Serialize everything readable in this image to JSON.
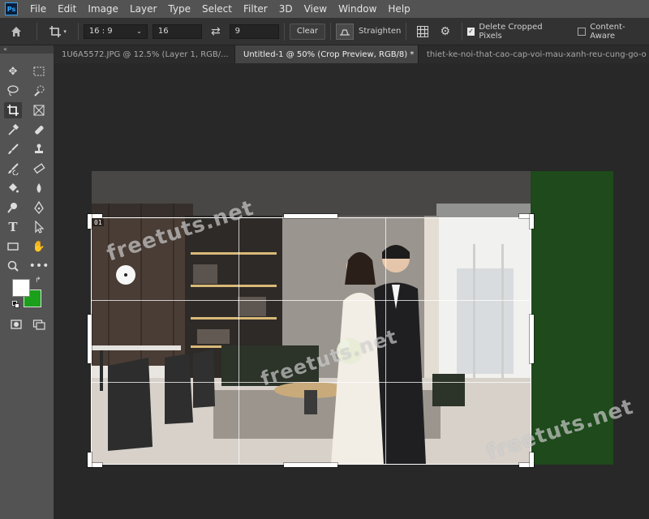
{
  "app": {
    "logo_text": "Ps"
  },
  "menu": [
    "File",
    "Edit",
    "Image",
    "Layer",
    "Type",
    "Select",
    "Filter",
    "3D",
    "View",
    "Window",
    "Help"
  ],
  "options": {
    "ratio_select": "16 : 9",
    "width_value": "16",
    "height_value": "9",
    "clear_label": "Clear",
    "straighten_label": "Straighten",
    "delete_cropped_label": "Delete Cropped Pixels",
    "delete_cropped_checked": true,
    "content_aware_label": "Content-Aware",
    "content_aware_checked": false
  },
  "tabs": [
    {
      "label": "1U6A5572.JPG @ 12.5% (Layer 1, RGB/...",
      "active": false
    },
    {
      "label": "Untitled-1 @ 50% (Crop Preview, RGB/8) *",
      "active": true
    },
    {
      "label": "thiet-ke-noi-that-cao-cap-voi-mau-xanh-reu-cung-go-o",
      "active": false
    }
  ],
  "toolbox": {
    "collapse_label": "«"
  },
  "canvas": {
    "crop_label": "01",
    "watermark_text": "freetuts.net",
    "colors": {
      "foreground": "#ffffff",
      "background": "#1aa01a",
      "doc_background": "#1e4a1c"
    }
  }
}
